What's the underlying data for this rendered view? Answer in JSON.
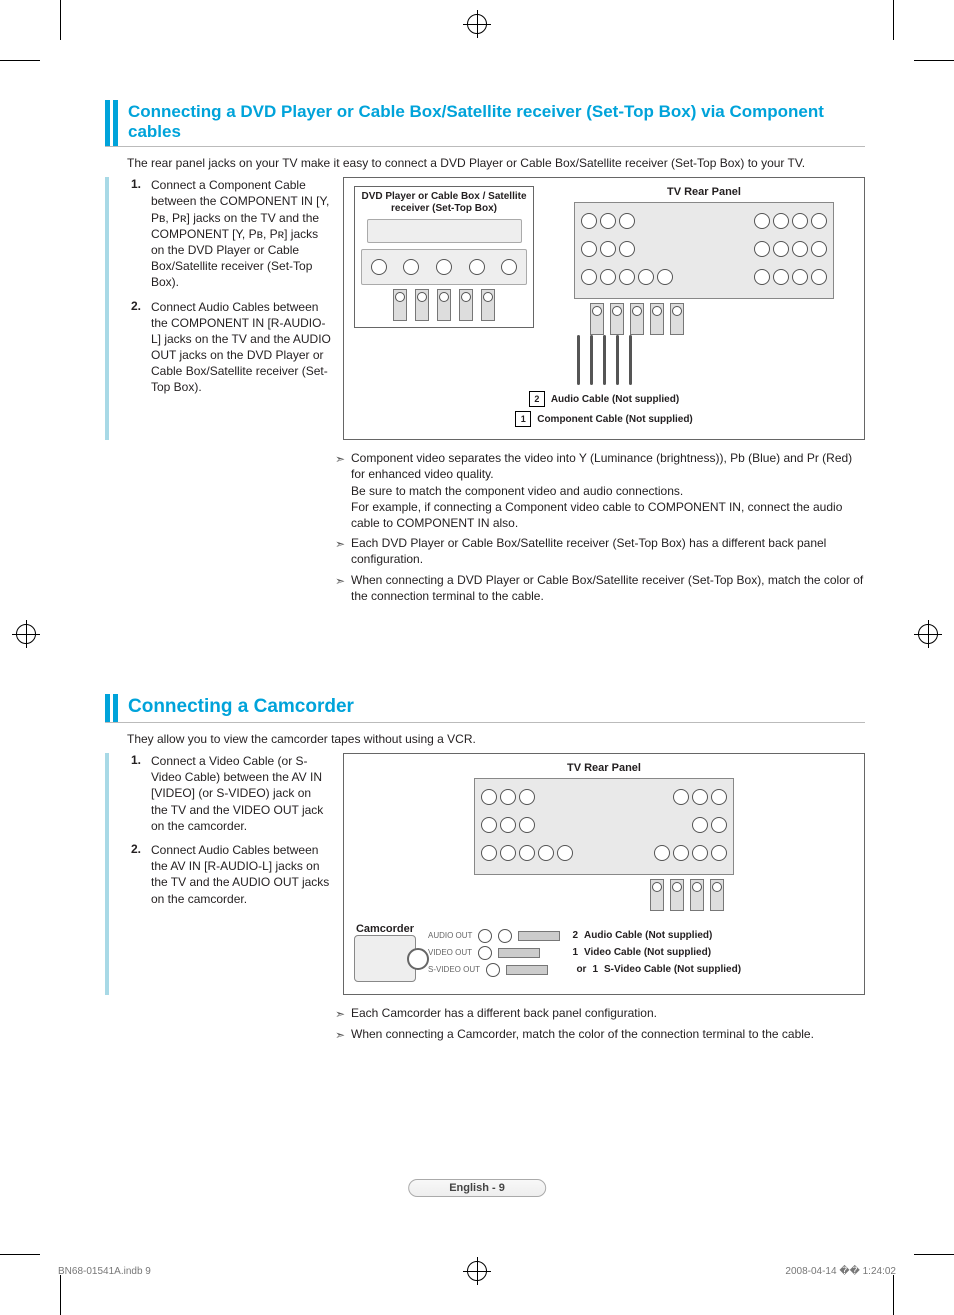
{
  "section1": {
    "title": "Connecting a DVD Player or Cable Box/Satellite receiver (Set-Top Box) via Component cables",
    "intro": "The rear panel jacks on your TV make it easy to connect a DVD Player or Cable Box/Satellite receiver (Set-Top Box) to your TV.",
    "steps": [
      "Connect a Component Cable between the COMPONENT IN [Y, Pʙ, Pʀ] jacks on the TV and the COMPONENT [Y, Pʙ, Pʀ]  jacks on the DVD Player or Cable Box/Satellite receiver (Set-Top Box).",
      "Connect Audio Cables between the COMPONENT IN [R-AUDIO-L] jacks on the TV and the AUDIO OUT jacks on the DVD Player or Cable Box/Satellite receiver (Set-Top Box)."
    ],
    "diagram": {
      "source_label": "DVD Player or Cable Box / Satellite receiver (Set-Top Box)",
      "tv_panel_label": "TV Rear Panel",
      "cable2": "Audio Cable (Not supplied)",
      "cable1": "Component Cable (Not supplied)"
    },
    "notes": [
      "Component video separates the video into Y (Luminance (brightness)), Pb (Blue) and Pr (Red) for enhanced video quality.\nBe sure to match the component video and audio connections.\nFor example, if connecting a Component video cable to COMPONENT IN, connect the audio cable to COMPONENT IN also.",
      "Each DVD Player or Cable Box/Satellite receiver (Set-Top Box) has a different back panel configuration.",
      "When connecting a DVD Player or Cable Box/Satellite receiver (Set-Top Box), match the color of the connection terminal to the cable."
    ]
  },
  "section2": {
    "title": "Connecting a Camcorder",
    "intro": "They allow you to view the camcorder tapes without using a VCR.",
    "steps": [
      "Connect a Video Cable (or S-Video Cable) between the AV IN [VIDEO] (or S-VIDEO) jack on the TV and the VIDEO OUT jack on the camcorder.",
      "Connect Audio Cables between the AV IN [R-AUDIO-L] jacks on the TV and the AUDIO OUT jacks on the camcorder."
    ],
    "diagram": {
      "tv_panel_label": "TV Rear Panel",
      "camcorder_label": "Camcorder",
      "audio_out": "AUDIO OUT",
      "video_out": "VIDEO OUT",
      "svideo_out": "S-VIDEO OUT",
      "or": "or",
      "cable2": "Audio Cable (Not supplied)",
      "cable1a": "Video Cable (Not supplied)",
      "cable1b": "S-Video Cable (Not supplied)",
      "num1": "1",
      "num2": "2"
    },
    "notes": [
      "Each Camcorder has a different back panel configuration.",
      "When connecting a Camcorder, match the color of the connection terminal to the cable."
    ]
  },
  "footer": {
    "lang_page": "English - 9",
    "doc_id": "BN68-01541A.indb   9",
    "timestamp": "2008-04-14   �� 1:24:02"
  },
  "nums": {
    "n1": "1",
    "n2": "2"
  }
}
